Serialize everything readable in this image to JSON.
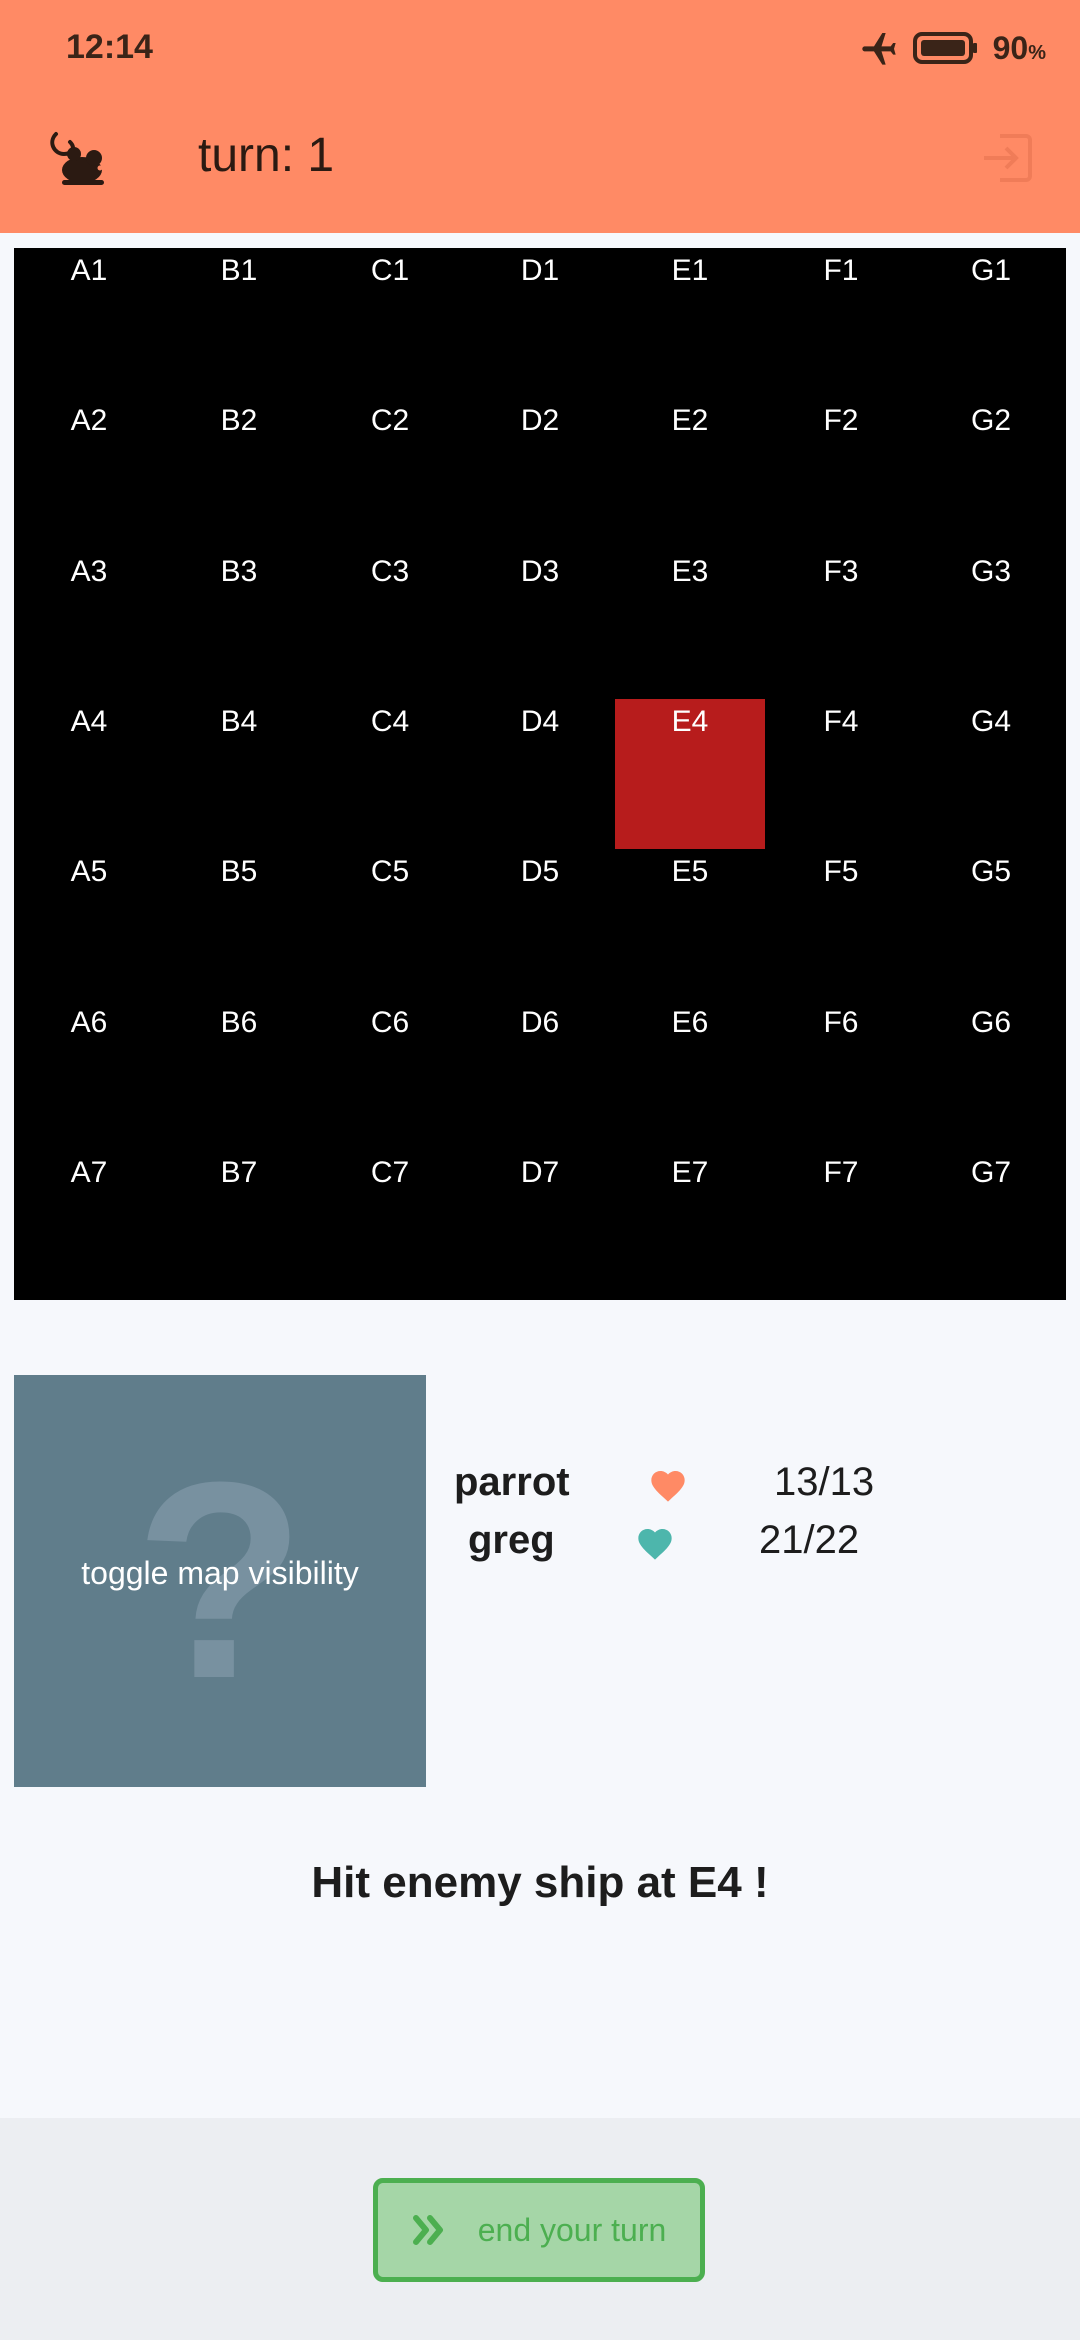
{
  "status_bar": {
    "time": "12:14",
    "battery_percent": "90",
    "battery_unit": "%",
    "icons": [
      "airplane-mode-icon",
      "battery-icon"
    ]
  },
  "app_bar": {
    "title": "turn: 1",
    "left_icon": "mouse-icon",
    "right_icon": "exit-icon",
    "background_color": "#ff8a65"
  },
  "board": {
    "columns": [
      "A",
      "B",
      "C",
      "D",
      "E",
      "F",
      "G"
    ],
    "rows": [
      "1",
      "2",
      "3",
      "4",
      "5",
      "6",
      "7"
    ],
    "cells": [
      [
        "A1",
        "B1",
        "C1",
        "D1",
        "E1",
        "F1",
        "G1"
      ],
      [
        "A2",
        "B2",
        "C2",
        "D2",
        "E2",
        "F2",
        "G2"
      ],
      [
        "A3",
        "B3",
        "C3",
        "D3",
        "E3",
        "F3",
        "G3"
      ],
      [
        "A4",
        "B4",
        "C4",
        "D4",
        "E4",
        "F4",
        "G4"
      ],
      [
        "A5",
        "B5",
        "C5",
        "D5",
        "E5",
        "F5",
        "G5"
      ],
      [
        "A6",
        "B6",
        "C6",
        "D6",
        "E6",
        "F6",
        "G6"
      ],
      [
        "A7",
        "B7",
        "C7",
        "D7",
        "E7",
        "F7",
        "G7"
      ]
    ],
    "hit_cells": [
      "E4"
    ],
    "background_color": "#000000",
    "hit_color": "#b71c1c"
  },
  "toggle_map": {
    "label": "toggle map visibility",
    "icon": "question-mark-icon",
    "background_color": "#607d8b"
  },
  "players": [
    {
      "name": "parrot",
      "hp": "13/13",
      "heart_color": "#ff8a65",
      "icon": "heart-icon"
    },
    {
      "name": "greg",
      "hp": "21/22",
      "heart_color": "#4db6ac",
      "icon": "heart-icon"
    }
  ],
  "message": "Hit enemy ship at E4 !",
  "end_turn": {
    "label": "end your turn",
    "icon": "double-chevron-right-icon",
    "color": "#4caf50",
    "background_color": "#a5d6a7"
  }
}
